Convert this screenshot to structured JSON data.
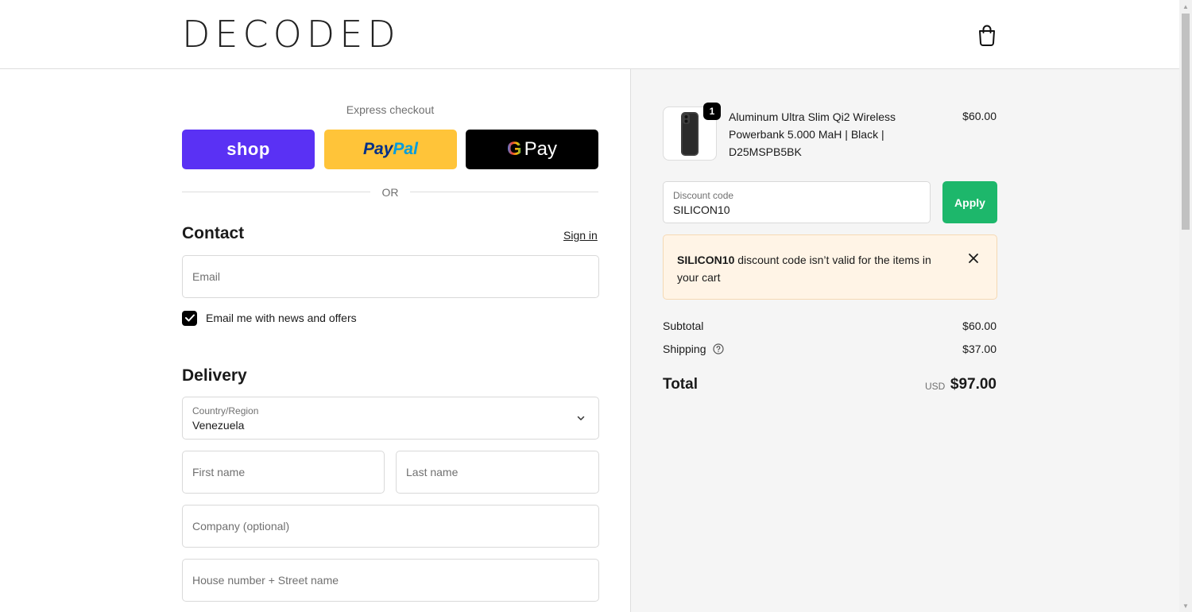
{
  "header": {
    "logo": "DECODED",
    "cart_icon": "shopping-bag-icon"
  },
  "express": {
    "title": "Express checkout",
    "shop_label": "shop",
    "paypal_label_1": "Pay",
    "paypal_label_2": "Pal",
    "gpay_g": "G",
    "gpay_label": "Pay",
    "or_text": "OR"
  },
  "contact": {
    "title": "Contact",
    "signin_label": "Sign in",
    "email_placeholder": "Email",
    "newsletter_label": "Email me with news and offers",
    "newsletter_checked": true
  },
  "delivery": {
    "title": "Delivery",
    "country_label": "Country/Region",
    "country_value": "Venezuela",
    "first_name_placeholder": "First name",
    "last_name_placeholder": "Last name",
    "company_placeholder": "Company (optional)",
    "address_placeholder": "House number + Street name"
  },
  "order": {
    "item": {
      "quantity": "1",
      "name": "Aluminum Ultra Slim Qi2 Wireless Powerbank 5.000 MaH | Black | D25MSPB5BK",
      "price": "$60.00"
    },
    "discount": {
      "label": "Discount code",
      "value": "SILICON10",
      "apply_label": "Apply"
    },
    "alert": {
      "code": "SILICON10",
      "message": " discount code isn’t valid for the items in your cart"
    },
    "subtotal_label": "Subtotal",
    "subtotal_value": "$60.00",
    "shipping_label": "Shipping",
    "shipping_value": "$37.00",
    "total_label": "Total",
    "total_currency": "USD",
    "total_value": "$97.00"
  },
  "colors": {
    "shop": "#5a31f4",
    "paypal": "#ffc439",
    "gpay": "#000000",
    "apply": "#1db76b",
    "alert_bg": "#fff4e6"
  }
}
